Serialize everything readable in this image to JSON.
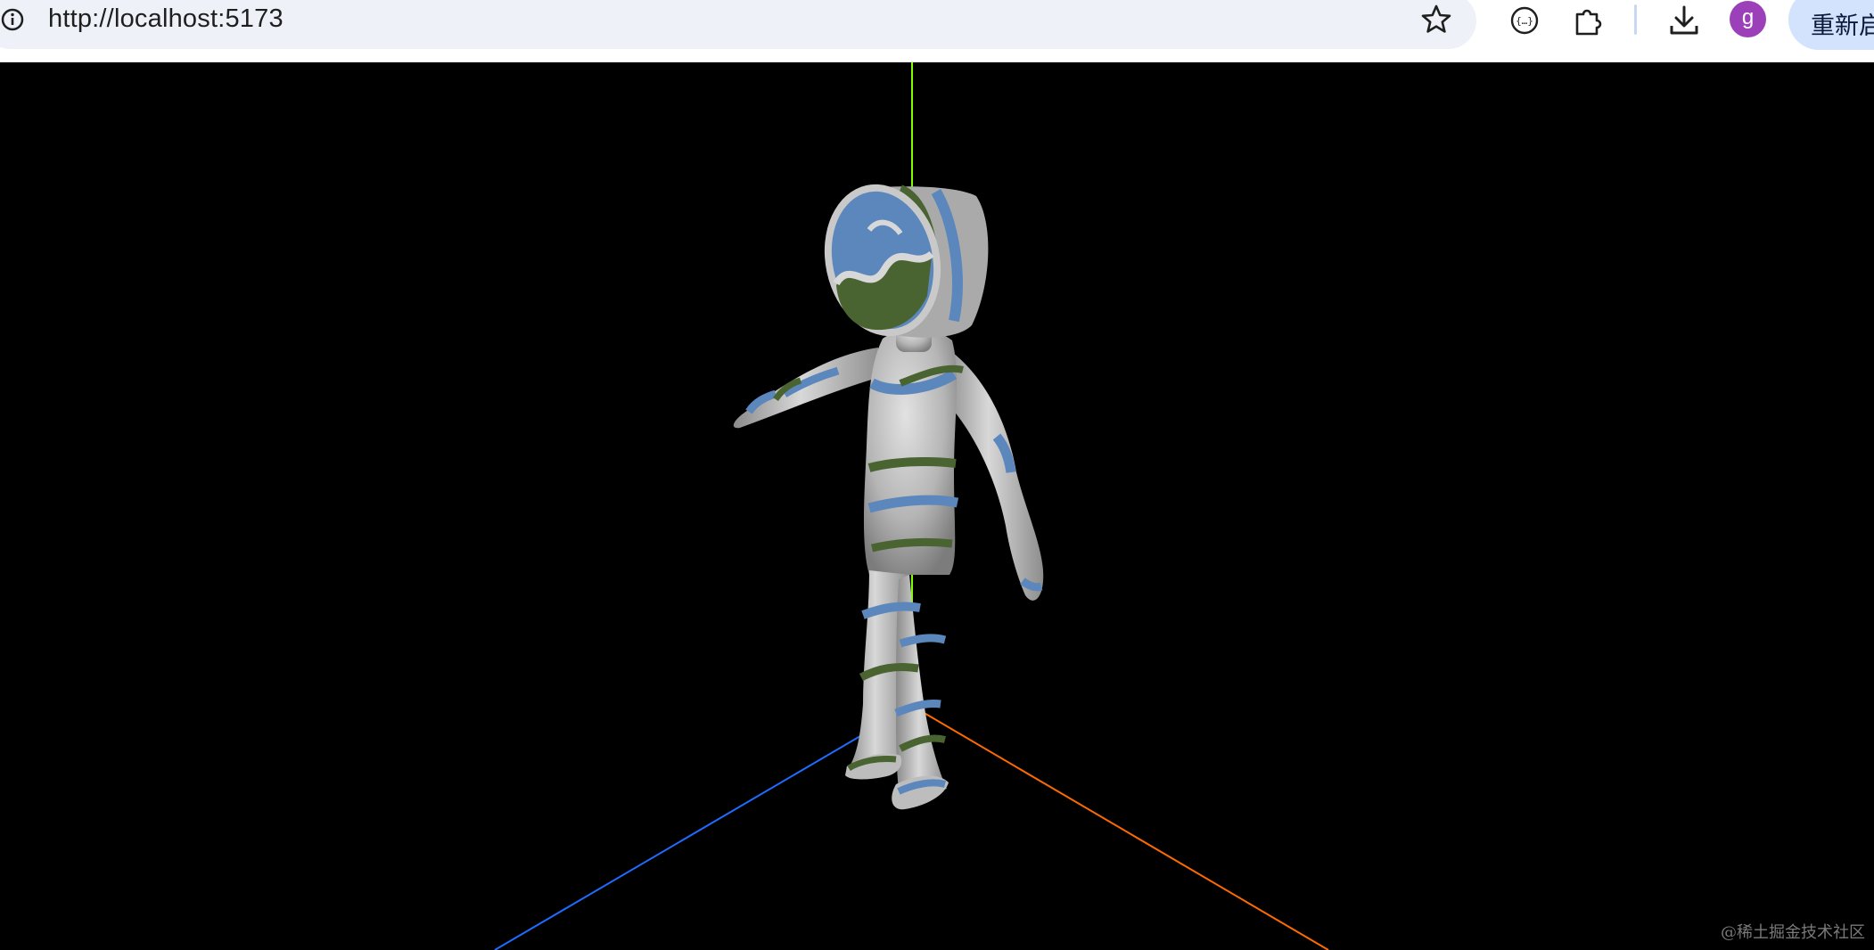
{
  "browser": {
    "url": "http://localhost:5173",
    "relaunch_label": "重新启",
    "profile_initial": "g",
    "icons": {
      "site_info": "info-icon",
      "bookmark": "star-icon",
      "devtools": "code-braces-icon",
      "extensions": "puzzle-icon",
      "downloads": "download-icon"
    },
    "colors": {
      "profile": "#9b40b8",
      "relaunch_bg": "#d3e3fd"
    }
  },
  "scene": {
    "axes": [
      {
        "name": "x-axis",
        "color": "#ff6a00"
      },
      {
        "name": "y-axis",
        "color": "#7fff00"
      },
      {
        "name": "z-axis",
        "color": "#1f6bff"
      }
    ],
    "model": {
      "name": "striped-character",
      "stripe_colors": [
        "#5b87bd",
        "#4a6431"
      ],
      "body_color": "#b9b9b9"
    },
    "background": "#000000"
  },
  "watermark": "@稀土掘金技术社区"
}
